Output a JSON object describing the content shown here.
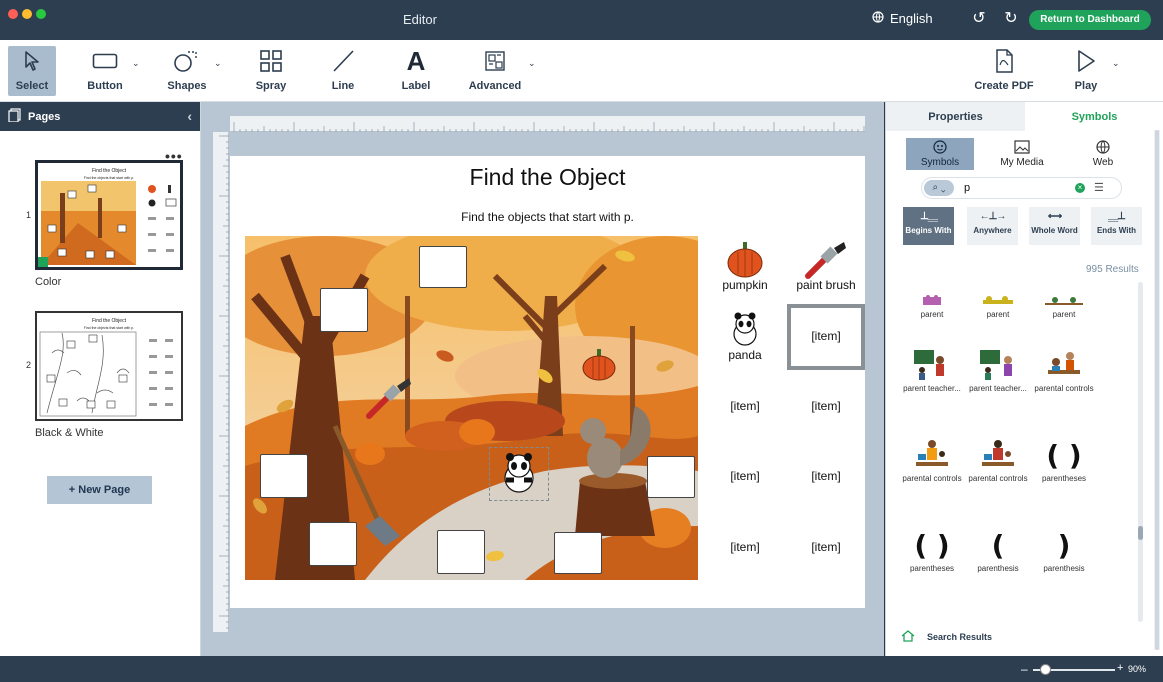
{
  "titlebar": {
    "title": "Editor",
    "language": "English",
    "return_button": "Return to Dashboard"
  },
  "toolbar": {
    "select": "Select",
    "button": "Button",
    "shapes": "Shapes",
    "spray": "Spray",
    "line": "Line",
    "label": "Label",
    "advanced": "Advanced",
    "create_pdf": "Create PDF",
    "play": "Play"
  },
  "pages_panel": {
    "heading": "Pages",
    "pages": [
      {
        "number": "1",
        "label": "Color"
      },
      {
        "number": "2",
        "label": "Black & White"
      }
    ],
    "new_page": "+ New Page"
  },
  "document": {
    "title": "Find the Object",
    "subtitle": "Find the objects that start with p.",
    "grid": [
      {
        "label": "pumpkin"
      },
      {
        "label": "paint brush"
      },
      {
        "label": "panda"
      },
      {
        "label": "[item]"
      },
      {
        "label": "[item]"
      },
      {
        "label": "[item]"
      },
      {
        "label": "[item]"
      },
      {
        "label": "[item]"
      },
      {
        "label": "[item]"
      },
      {
        "label": "[item]"
      }
    ]
  },
  "right_panel": {
    "tabs": [
      "Properties",
      "Symbols"
    ],
    "sources": [
      "Symbols",
      "My Media",
      "Web"
    ],
    "search_value": "p",
    "modes": [
      "Begins With",
      "Anywhere",
      "Whole Word",
      "Ends With"
    ],
    "results_count": "995 Results",
    "symbols": [
      {
        "label": "parent",
        "icon": "parent-icon"
      },
      {
        "label": "parent",
        "icon": "parent-icon"
      },
      {
        "label": "parent",
        "icon": "parent-icon"
      },
      {
        "label": "parent teacher...",
        "icon": "parent-teacher-icon"
      },
      {
        "label": "parent teacher...",
        "icon": "parent-teacher-icon"
      },
      {
        "label": "parental controls",
        "icon": "parental-controls-icon"
      },
      {
        "label": "parental controls",
        "icon": "parental-controls-icon"
      },
      {
        "label": "parental controls",
        "icon": "parental-controls-icon"
      },
      {
        "label": "parentheses",
        "icon": "parentheses-icon"
      },
      {
        "label": "parentheses",
        "icon": "parentheses-icon"
      },
      {
        "label": "parenthesis",
        "icon": "parenthesis-icon"
      },
      {
        "label": "parenthesis",
        "icon": "parenthesis-icon"
      }
    ],
    "footer": "Search Results"
  },
  "status": {
    "zoom": "90%"
  },
  "colors": {
    "accent": "#1fa35a",
    "chrome": "#2d3e50",
    "canvas_bg": "#b7c6d2"
  }
}
